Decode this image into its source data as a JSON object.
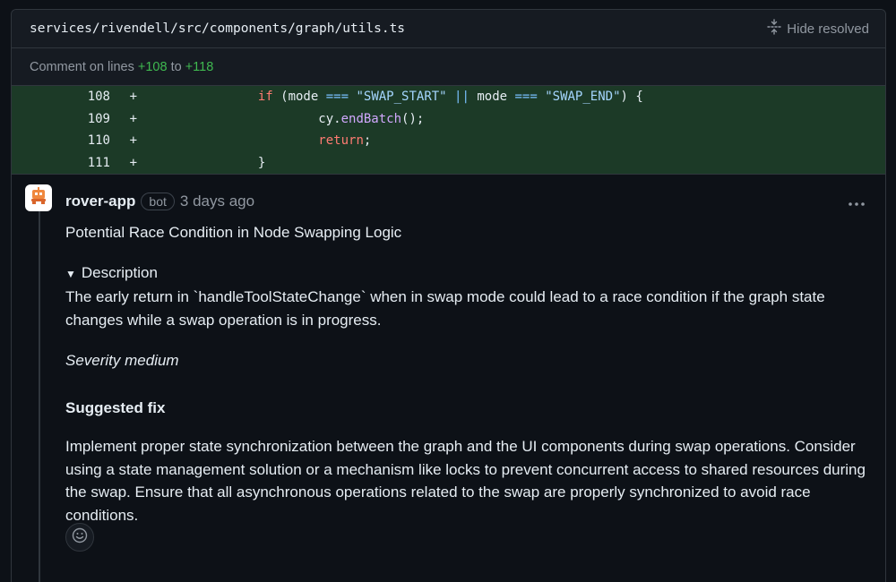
{
  "file": {
    "path": "services/rivendell/src/components/graph/utils.ts",
    "hide_resolved": "Hide resolved"
  },
  "range": {
    "prefix": "Comment on lines",
    "start": "+108",
    "joiner": "to",
    "end": "+118"
  },
  "diff": {
    "lines": [
      {
        "num": "108",
        "sign": "+"
      },
      {
        "num": "109",
        "sign": "+"
      },
      {
        "num": "110",
        "sign": "+"
      },
      {
        "num": "111",
        "sign": "+"
      }
    ],
    "code": {
      "l108": {
        "kw_if": "if",
        "p1": " (mode ",
        "eq1": "===",
        "s1": " \"SWAP_START\" ",
        "or": "||",
        "p2": " mode ",
        "eq2": "===",
        "s2": " \"SWAP_END\"",
        "p3": ") {"
      },
      "l109": {
        "obj": "cy.",
        "fn": "endBatch",
        "rest": "();"
      },
      "l110": {
        "kw": "return",
        "rest": ";"
      },
      "l111": {
        "brace": "}"
      }
    }
  },
  "comment": {
    "author": "rover-app",
    "badge": "bot",
    "time": "3 days ago",
    "title": "Potential Race Condition in Node Swapping Logic",
    "summary": "Description",
    "description": "The early return in `handleToolStateChange` when in swap mode could lead to a race condition if the graph state changes while a swap operation is in progress.",
    "severity": "Severity medium",
    "fix_heading": "Suggested fix",
    "fix_body": "Implement proper state synchronization between the graph and the UI components during swap operations. Consider using a state management solution or a mechanism like locks to prevent concurrent access to shared resources during the swap. Ensure that all asynchronous operations related to the swap are properly synchronized to avoid race conditions."
  },
  "colors": {
    "background": "#0d1117",
    "diff_added_bg": "#1c3a27",
    "added_text": "#3fb950",
    "keyword": "#ff7b72",
    "string": "#a5d6ff",
    "function": "#d2a8ff"
  },
  "icons": {
    "hide_resolved": "unfold-icon",
    "avatar": "robot-icon",
    "more": "kebab-horizontal-icon",
    "reaction": "smiley-icon"
  }
}
